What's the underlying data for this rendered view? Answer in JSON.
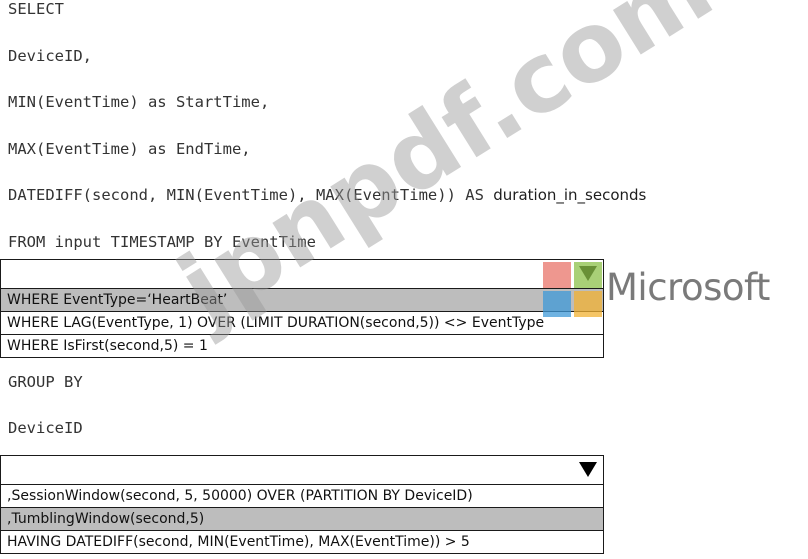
{
  "code_lines": [
    "SELECT",
    "DeviceID,",
    "MIN(EventTime) as StartTime,",
    "MAX(EventTime) as EndTime,",
    "DATEDIFF(second, MIN(EventTime), MAX(EventTime)) AS ",
    "FROM input TIMESTAMP BY EventTime",
    "GROUP BY",
    "DeviceID"
  ],
  "code_line5_tail": "duration_in_seconds",
  "dropdown1": {
    "selected_value": "",
    "options": [
      "WHERE EventType=‘HeartBeat’",
      "WHERE LAG(EventType, 1) OVER (LIMIT DURATION(second,5)) <> EventType",
      "WHERE IsFirst(second,5) = 1"
    ],
    "highlighted_index": 0
  },
  "dropdown2": {
    "selected_value": "",
    "options": [
      ",SessionWindow(second, 5, 50000) OVER (PARTITION BY DeviceID)",
      ",TumblingWindow(second,5)",
      "HAVING DATEDIFF(second, MIN(EventTime), MAX(EventTime)) > 5"
    ],
    "highlighted_index": 1
  },
  "brand": {
    "logo_text": "Microsoft"
  },
  "watermark": {
    "text": "jpnpdf.com"
  },
  "colors": {
    "highlight": "#bdbdbd",
    "logo_red": "#e8746a",
    "logo_green": "#8cc04a",
    "logo_blue": "#3f9ad8",
    "logo_yellow": "#f2b233"
  },
  "icons": {
    "dropdown_arrow": "triangle-down-icon"
  }
}
